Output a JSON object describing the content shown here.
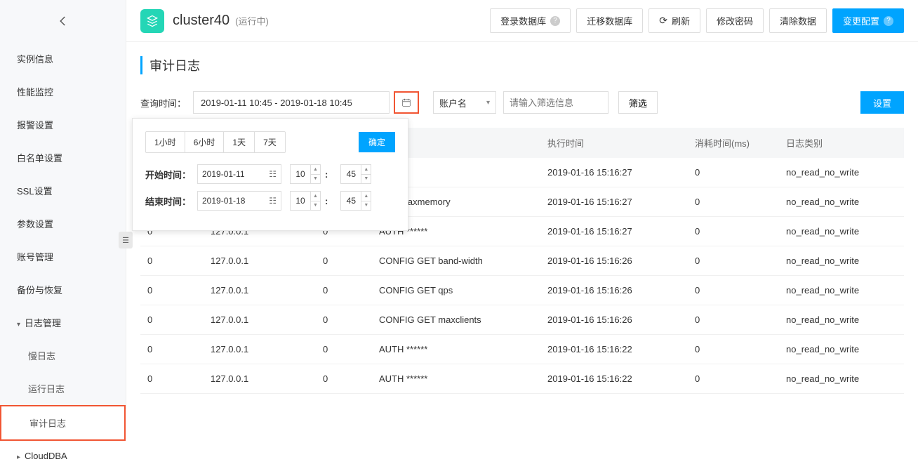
{
  "sidebar": {
    "items": [
      {
        "label": "实例信息"
      },
      {
        "label": "性能监控"
      },
      {
        "label": "报警设置"
      },
      {
        "label": "白名单设置"
      },
      {
        "label": "SSL设置"
      },
      {
        "label": "参数设置"
      },
      {
        "label": "账号管理"
      },
      {
        "label": "备份与恢复"
      },
      {
        "label": "日志管理"
      },
      {
        "label": "慢日志"
      },
      {
        "label": "运行日志"
      },
      {
        "label": "审计日志"
      },
      {
        "label": "CloudDBA"
      }
    ]
  },
  "header": {
    "title": "cluster40",
    "status": "(运行中)",
    "login_db": "登录数据库",
    "migrate_db": "迁移数据库",
    "refresh": "刷新",
    "change_pw": "修改密码",
    "clear_data": "清除数据",
    "change_config": "变更配置"
  },
  "page": {
    "title": "审计日志",
    "query_time_label": "查询时间：",
    "date_range": "2019-01-11 10:45   -   2019-01-18 10:45",
    "account_select": "账户名",
    "filter_placeholder": "请输入筛选信息",
    "filter_btn": "筛选",
    "settings_btn": "设置"
  },
  "popover": {
    "presets": [
      "1小时",
      "6小时",
      "1天",
      "7天"
    ],
    "confirm": "确定",
    "start_label": "开始时间：",
    "end_label": "结束时间：",
    "start_date": "2019-01-11",
    "end_date": "2019-01-18",
    "start_h": "10",
    "start_m": "45",
    "end_h": "10",
    "end_m": "45"
  },
  "table": {
    "headers": {
      "exec_time": "执行时间",
      "elapsed": "消耗时间(ms)",
      "log_type": "日志类别"
    },
    "hidden_headers": {
      "db": "",
      "ip": "",
      "acc": "",
      "cmd": ""
    },
    "rows": [
      {
        "db": "",
        "ip": "",
        "acc": "",
        "cmd": "****",
        "time": "2019-01-16 15:16:27",
        "ms": "0",
        "type": "no_read_no_write"
      },
      {
        "db": "",
        "ip": "",
        "acc": "",
        "cmd": "GET maxmemory",
        "time": "2019-01-16 15:16:27",
        "ms": "0",
        "type": "no_read_no_write"
      },
      {
        "db": "0",
        "ip": "127.0.0.1",
        "acc": "0",
        "cmd": "AUTH ******",
        "time": "2019-01-16 15:16:27",
        "ms": "0",
        "type": "no_read_no_write"
      },
      {
        "db": "0",
        "ip": "127.0.0.1",
        "acc": "0",
        "cmd": "CONFIG GET band-width",
        "time": "2019-01-16 15:16:26",
        "ms": "0",
        "type": "no_read_no_write"
      },
      {
        "db": "0",
        "ip": "127.0.0.1",
        "acc": "0",
        "cmd": "CONFIG GET qps",
        "time": "2019-01-16 15:16:26",
        "ms": "0",
        "type": "no_read_no_write"
      },
      {
        "db": "0",
        "ip": "127.0.0.1",
        "acc": "0",
        "cmd": "CONFIG GET maxclients",
        "time": "2019-01-16 15:16:26",
        "ms": "0",
        "type": "no_read_no_write"
      },
      {
        "db": "0",
        "ip": "127.0.0.1",
        "acc": "0",
        "cmd": "AUTH ******",
        "time": "2019-01-16 15:16:22",
        "ms": "0",
        "type": "no_read_no_write"
      },
      {
        "db": "0",
        "ip": "127.0.0.1",
        "acc": "0",
        "cmd": "AUTH ******",
        "time": "2019-01-16 15:16:22",
        "ms": "0",
        "type": "no_read_no_write"
      }
    ]
  }
}
